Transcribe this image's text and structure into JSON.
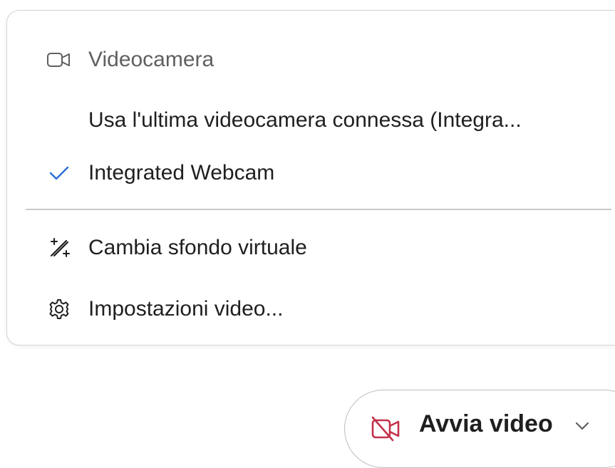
{
  "menu": {
    "header": {
      "label": "Videocamera",
      "icon": "video-camera-icon"
    },
    "items": [
      {
        "label": "Usa l'ultima videocamera connessa (Integra...",
        "checked": false
      },
      {
        "label": "Integrated Webcam",
        "checked": true,
        "icon": "checkmark-icon"
      },
      {
        "label": "Cambia sfondo virtuale",
        "icon": "magic-wand-icon"
      },
      {
        "label": "Impostazioni video...",
        "icon": "gear-icon"
      }
    ]
  },
  "video_button": {
    "label": "Avvia video",
    "icon": "video-camera-off-icon",
    "dropdown_icon": "chevron-down-icon"
  },
  "colors": {
    "check": "#2b6fd6",
    "camera_off": "#c4314b",
    "text": "#1f1f1f",
    "muted_text": "#5f5f5f"
  }
}
